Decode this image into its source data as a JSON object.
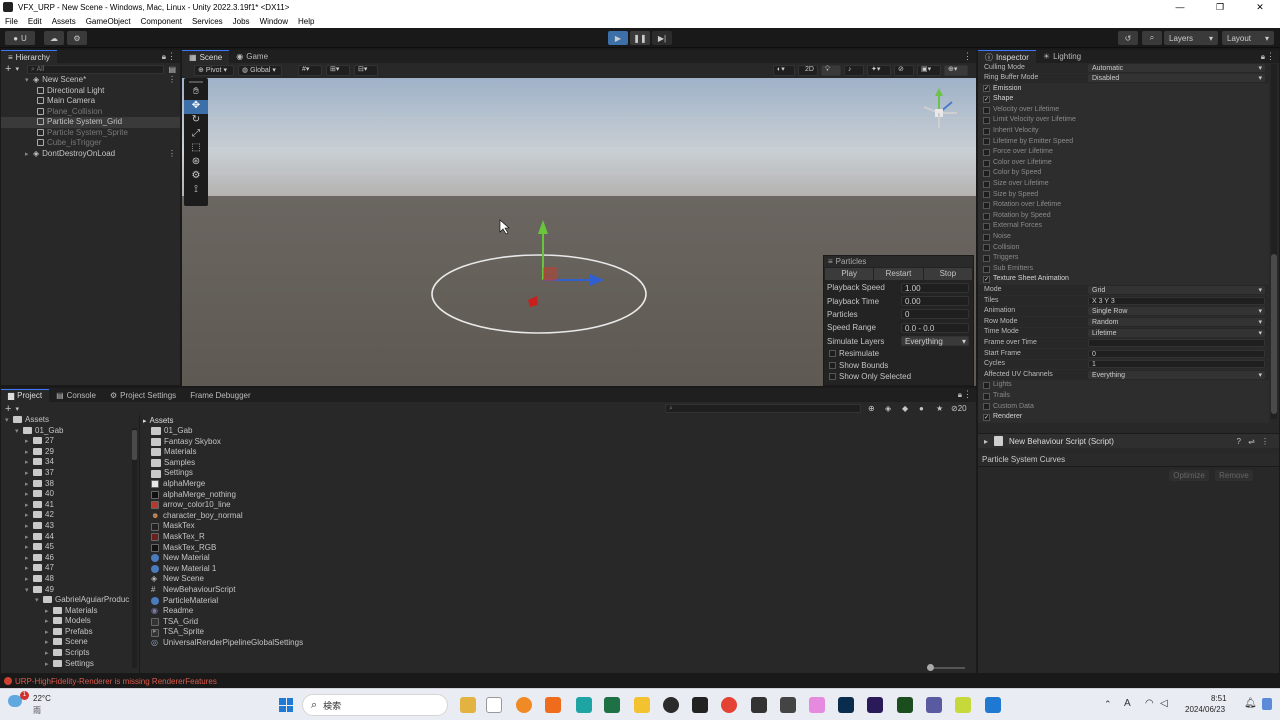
{
  "window": {
    "title": "VFX_URP - New Scene - Windows, Mac, Linux - Unity 2022.3.19f1* <DX11>",
    "controls": [
      "—",
      "❐",
      "✕"
    ]
  },
  "menu": [
    "File",
    "Edit",
    "Assets",
    "GameObject",
    "Component",
    "Services",
    "Jobs",
    "Window",
    "Help"
  ],
  "toolbar": {
    "account_label": "U",
    "layers_label": "Layers",
    "layout_label": "Layout"
  },
  "hierarchy": {
    "tab": "Hierarchy",
    "search_placeholder": "All",
    "items": [
      {
        "label": "New Scene*",
        "indent": 1,
        "kind": "scene",
        "dim": false,
        "selected": false
      },
      {
        "label": "Directional Light",
        "indent": 2,
        "kind": "obj",
        "dim": false,
        "selected": false
      },
      {
        "label": "Main Camera",
        "indent": 2,
        "kind": "obj",
        "dim": false,
        "selected": false
      },
      {
        "label": "Plane_Collision",
        "indent": 2,
        "kind": "obj",
        "dim": true,
        "selected": false
      },
      {
        "label": "Particle System_Grid",
        "indent": 2,
        "kind": "obj",
        "dim": false,
        "selected": true
      },
      {
        "label": "Particle System_Sprite",
        "indent": 2,
        "kind": "obj",
        "dim": true,
        "selected": false
      },
      {
        "label": "Cube_isTrigger",
        "indent": 2,
        "kind": "obj",
        "dim": true,
        "selected": false
      },
      {
        "label": "DontDestroyOnLoad",
        "indent": 1,
        "kind": "scene",
        "dim": false,
        "selected": false
      }
    ]
  },
  "scene": {
    "tabs": [
      "Scene",
      "Game"
    ],
    "pivot": "Pivot",
    "global": "Global",
    "mode2d": "2D"
  },
  "particles_overlay": {
    "title": "Particles",
    "buttons": [
      "Play",
      "Restart",
      "Stop"
    ],
    "rows": [
      {
        "label": "Playback Speed",
        "value": "1.00"
      },
      {
        "label": "Playback Time",
        "value": "0.00"
      },
      {
        "label": "Particles",
        "value": "0"
      },
      {
        "label": "Speed Range",
        "value": "0.0 - 0.0"
      },
      {
        "label": "Simulate Layers",
        "value": "Everything"
      }
    ],
    "checks": [
      "Resimulate",
      "Show Bounds",
      "Show Only Selected"
    ]
  },
  "inspector": {
    "tabs": [
      "Inspector",
      "Lighting"
    ],
    "top_rows": [
      {
        "label": "Culling Mode",
        "value": "Automatic"
      },
      {
        "label": "Ring Buffer Mode",
        "value": "Disabled"
      }
    ],
    "modules": [
      {
        "label": "Emission",
        "on": true
      },
      {
        "label": "Shape",
        "on": true
      },
      {
        "label": "Velocity over Lifetime",
        "on": false
      },
      {
        "label": "Limit Velocity over Lifetime",
        "on": false
      },
      {
        "label": "Inherit Velocity",
        "on": false
      },
      {
        "label": "Lifetime by Emitter Speed",
        "on": false
      },
      {
        "label": "Force over Lifetime",
        "on": false
      },
      {
        "label": "Color over Lifetime",
        "on": false
      },
      {
        "label": "Color by Speed",
        "on": false
      },
      {
        "label": "Size over Lifetime",
        "on": false
      },
      {
        "label": "Size by Speed",
        "on": false
      },
      {
        "label": "Rotation over Lifetime",
        "on": false
      },
      {
        "label": "Rotation by Speed",
        "on": false
      },
      {
        "label": "External Forces",
        "on": false
      },
      {
        "label": "Noise",
        "on": false
      },
      {
        "label": "Collision",
        "on": false
      },
      {
        "label": "Triggers",
        "on": false
      },
      {
        "label": "Sub Emitters",
        "on": false
      },
      {
        "label": "Texture Sheet Animation",
        "on": true
      }
    ],
    "tsa_rows": [
      {
        "label": "Mode",
        "value": "Grid"
      },
      {
        "label": "Tiles",
        "value": "X 3            Y 3"
      },
      {
        "label": "Animation",
        "value": "Single Row"
      },
      {
        "label": "Row Mode",
        "value": "Random"
      },
      {
        "label": "Time Mode",
        "value": "Lifetime"
      },
      {
        "label": "Frame over Time",
        "value": ""
      },
      {
        "label": "Start Frame",
        "value": "0"
      },
      {
        "label": "Cycles",
        "value": "1"
      },
      {
        "label": "Affected UV Channels",
        "value": "Everything"
      }
    ],
    "tail_modules": [
      {
        "label": "Lights",
        "on": false
      },
      {
        "label": "Trails",
        "on": false
      },
      {
        "label": "Custom Data",
        "on": false
      },
      {
        "label": "Renderer",
        "on": true
      }
    ],
    "script_component": "New Behaviour Script (Script)",
    "curves_title": "Particle System Curves",
    "optimize": "Optimize",
    "remove": "Remove"
  },
  "project": {
    "tabs": [
      "Project",
      "Console",
      "Project Settings",
      "Frame Debugger"
    ],
    "count": "20",
    "tree": [
      {
        "label": "Assets",
        "indent": 0,
        "open": true
      },
      {
        "label": "01_Gab",
        "indent": 1,
        "open": true
      },
      {
        "label": "27",
        "indent": 2,
        "open": false
      },
      {
        "label": "29",
        "indent": 2,
        "open": false
      },
      {
        "label": "34",
        "indent": 2,
        "open": false
      },
      {
        "label": "37",
        "indent": 2,
        "open": false
      },
      {
        "label": "38",
        "indent": 2,
        "open": false
      },
      {
        "label": "40",
        "indent": 2,
        "open": false
      },
      {
        "label": "41",
        "indent": 2,
        "open": false
      },
      {
        "label": "42",
        "indent": 2,
        "open": false
      },
      {
        "label": "43",
        "indent": 2,
        "open": false
      },
      {
        "label": "44",
        "indent": 2,
        "open": false
      },
      {
        "label": "45",
        "indent": 2,
        "open": false
      },
      {
        "label": "46",
        "indent": 2,
        "open": false
      },
      {
        "label": "47",
        "indent": 2,
        "open": false
      },
      {
        "label": "48",
        "indent": 2,
        "open": false
      },
      {
        "label": "49",
        "indent": 2,
        "open": true
      },
      {
        "label": "GabrielAguiarProduc",
        "indent": 3,
        "open": true
      },
      {
        "label": "Materials",
        "indent": 4,
        "open": false
      },
      {
        "label": "Models",
        "indent": 4,
        "open": false
      },
      {
        "label": "Prefabs",
        "indent": 4,
        "open": false
      },
      {
        "label": "Scene",
        "indent": 4,
        "open": false
      },
      {
        "label": "Scripts",
        "indent": 4,
        "open": false
      },
      {
        "label": "Settings",
        "indent": 4,
        "open": false
      }
    ],
    "assets_header": "Assets",
    "assets": [
      {
        "label": "01_Gab",
        "icon": "folder",
        "color": "#c9c9c9"
      },
      {
        "label": "Fantasy Skybox",
        "icon": "folder",
        "color": "#c9c9c9"
      },
      {
        "label": "Materials",
        "icon": "folder",
        "color": "#c9c9c9"
      },
      {
        "label": "Samples",
        "icon": "folder",
        "color": "#c9c9c9"
      },
      {
        "label": "Settings",
        "icon": "folder",
        "color": "#c9c9c9"
      },
      {
        "label": "alphaMerge",
        "icon": "tex",
        "color": "#e8e8e8"
      },
      {
        "label": "alphaMerge_nothing",
        "icon": "tex",
        "color": "#111111"
      },
      {
        "label": "arrow_color10_line",
        "icon": "tex",
        "color": "#b03a2e"
      },
      {
        "label": "character_boy_normal",
        "icon": "model",
        "color": "#d98a4a"
      },
      {
        "label": "MaskTex",
        "icon": "tex",
        "color": "#222222"
      },
      {
        "label": "MaskTex_R",
        "icon": "tex",
        "color": "#6a1f1f"
      },
      {
        "label": "MaskTex_RGB",
        "icon": "tex",
        "color": "#111111"
      },
      {
        "label": "New Material",
        "icon": "mat",
        "color": "#4a7bbd"
      },
      {
        "label": "New Material 1",
        "icon": "mat",
        "color": "#4a7bbd"
      },
      {
        "label": "New Scene",
        "icon": "scene",
        "color": "#bbbbbb"
      },
      {
        "label": "NewBehaviourScript",
        "icon": "script",
        "color": "#6b8f6b"
      },
      {
        "label": "ParticleMaterial",
        "icon": "mat",
        "color": "#4a7bbd"
      },
      {
        "label": "Readme",
        "icon": "readme",
        "color": "#7a7aa8"
      },
      {
        "label": "TSA_Grid",
        "icon": "tex",
        "color": "#333333"
      },
      {
        "label": "TSA_Sprite",
        "icon": "tex",
        "color": "#333333"
      },
      {
        "label": "UniversalRenderPipelineGlobalSettings",
        "icon": "asset",
        "color": "#8fa7c7"
      }
    ]
  },
  "status": {
    "message": "URP-HighFidelity-Renderer is missing RendererFeatures",
    "color": "#e05a4a"
  },
  "taskbar": {
    "weather_temp": "22°C",
    "weather_desc": "雨",
    "search_label": "検索",
    "time": "8:51",
    "date": "2024/06/23"
  }
}
